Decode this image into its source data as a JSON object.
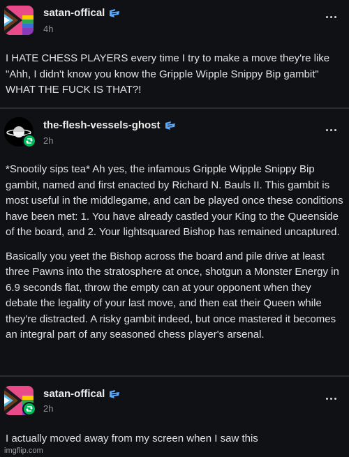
{
  "posts": [
    {
      "username": "satan-offical",
      "time": "4h",
      "reblog": false,
      "paragraphs": [
        "I HATE CHESS PLAYERS every time I try to make a move they're like \"Ahh, I didn't know you know the Gripple Wipple Snippy Bip gambit\" WHAT THE FUCK IS THAT?!"
      ]
    },
    {
      "username": "the-flesh-vessels-ghost",
      "time": "2h",
      "reblog": true,
      "paragraphs": [
        "*Snootily sips tea* Ah yes, the infamous Gripple Wipple Snippy Bip gambit, named and first enacted by Richard N. Bauls II. This gambit is most useful in the middlegame, and can be played once these conditions have been met: 1. You have already castled your King to the Queenside of the board, and 2. Your lightsquared Bishop has remained uncaptured.",
        "Basically you yeet the Bishop across the board and pile drive at least three Pawns into the stratosphere at once, shotgun a Monster Energy in 6.9 seconds flat, throw the empty can at your opponent when they debate the legality of your last move, and then eat their Queen while they're distracted. A risky gambit indeed, but once mastered it becomes an integral part of any seasoned chess player's arsenal."
      ]
    },
    {
      "username": "satan-offical",
      "time": "2h",
      "reblog": true,
      "paragraphs": [
        "I actually moved away from my screen when I saw this"
      ]
    }
  ],
  "watermark": "imgflip.com",
  "colors": {
    "background": "#0f1114",
    "divider": "#2a2d31",
    "reblog_badge": "#00b85c",
    "verified_badge": "#5aa8ff"
  },
  "icons": {
    "verified": "verified-badge-icon",
    "reblog": "reblog-icon",
    "more": "more-options-icon"
  }
}
